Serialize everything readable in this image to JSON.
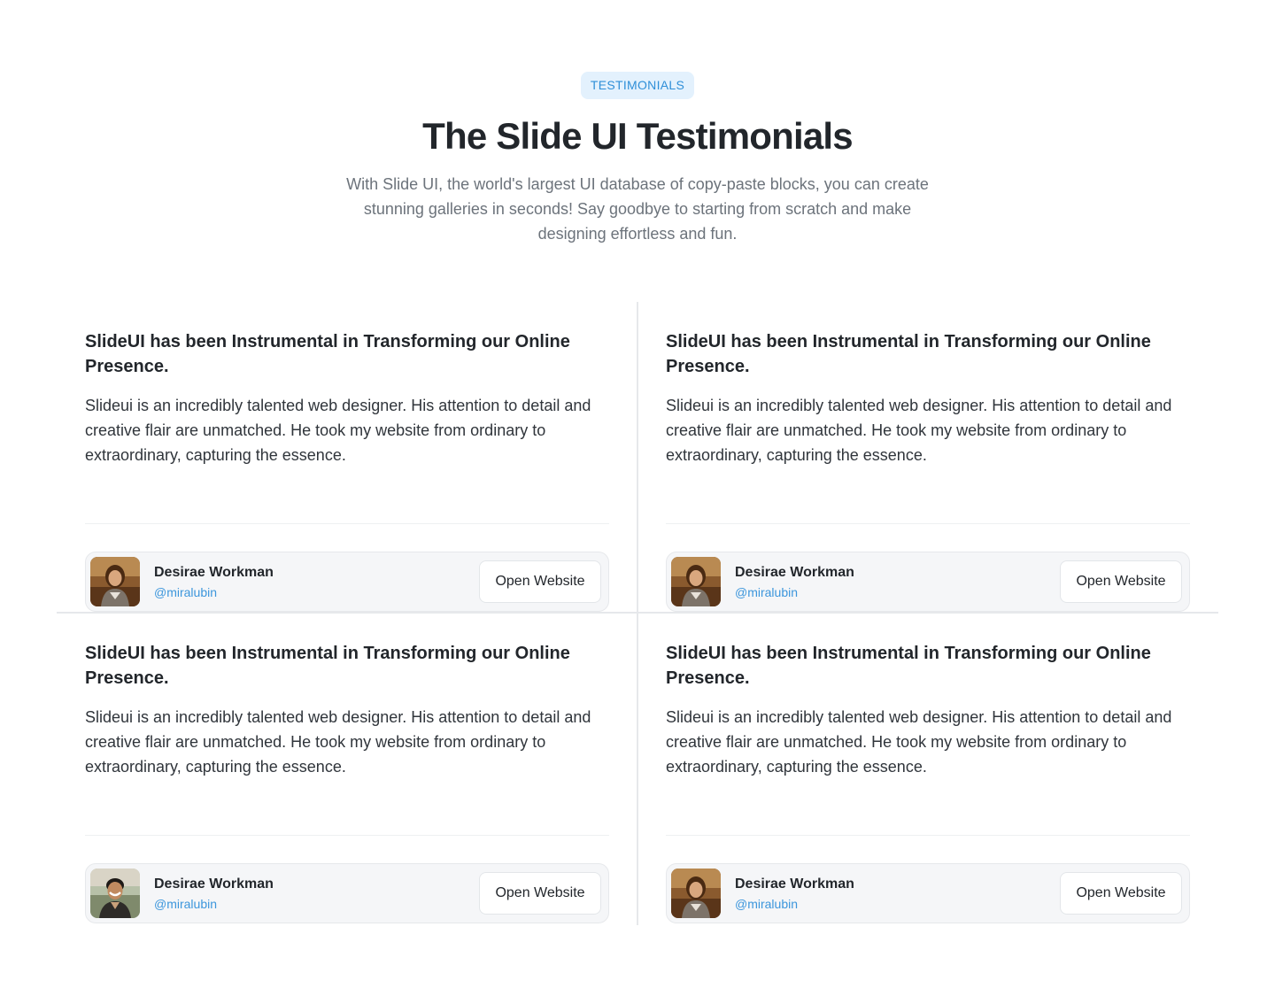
{
  "header": {
    "badge": "TESTIMONIALS",
    "title": "The Slide UI Testimonials",
    "subtitle": "With Slide UI, the world's largest UI database of copy-paste blocks, you can create stunning galleries in seconds! Say goodbye to starting from scratch and make designing effortless and fun."
  },
  "colors": {
    "accent": "#2f8fd8",
    "badge_bg": "#e3f1fd",
    "handle": "#3c96dc"
  },
  "testimonials": [
    {
      "title": "SlideUI has been Instrumental in Transforming our Online Presence.",
      "body": "Slideui is an incredibly talented web designer. His attention to detail and creative flair are unmatched. He took my website from ordinary to extraordinary, capturing the essence.",
      "name": "Desirae Workman",
      "handle": "@miralubin",
      "button": "Open Website",
      "avatar": "woman-portrait"
    },
    {
      "title": "SlideUI has been Instrumental in Transforming our Online Presence.",
      "body": "Slideui is an incredibly talented web designer. His attention to detail and creative flair are unmatched. He took my website from ordinary to extraordinary, capturing the essence.",
      "name": "Desirae Workman",
      "handle": "@miralubin",
      "button": "Open Website",
      "avatar": "woman-portrait"
    },
    {
      "title": "SlideUI has been Instrumental in Transforming our Online Presence.",
      "body": "Slideui is an incredibly talented web designer. His attention to detail and creative flair are unmatched. He took my website from ordinary to extraordinary, capturing the essence.",
      "name": "Desirae Workman",
      "handle": "@miralubin",
      "button": "Open Website",
      "avatar": "man-portrait"
    },
    {
      "title": "SlideUI has been Instrumental in Transforming our Online Presence.",
      "body": "Slideui is an incredibly talented web designer. His attention to detail and creative flair are unmatched. He took my website from ordinary to extraordinary, capturing the essence.",
      "name": "Desirae Workman",
      "handle": "@miralubin",
      "button": "Open Website",
      "avatar": "woman-portrait"
    }
  ]
}
